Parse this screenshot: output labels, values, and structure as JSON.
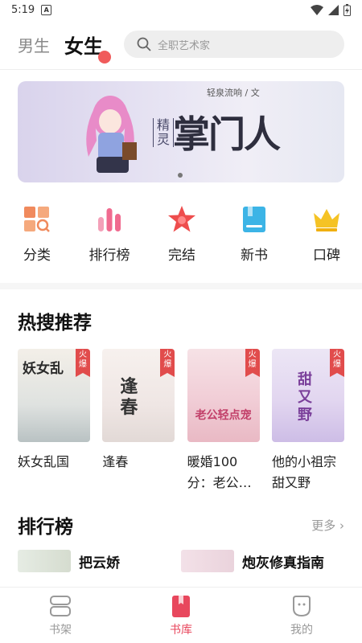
{
  "status": {
    "time": "5:19",
    "notification_letter": "A"
  },
  "header": {
    "tabs": [
      {
        "label": "男生"
      },
      {
        "label": "女生"
      }
    ],
    "search_placeholder": "全职艺术家"
  },
  "banner": {
    "author": "轻泉流响 / 文",
    "tag": "精灵",
    "title": "掌门人"
  },
  "categories": [
    {
      "label": "分类",
      "icon": "category-grid-icon",
      "color": "#f08a5d"
    },
    {
      "label": "排行榜",
      "icon": "ranking-bars-icon",
      "color": "#f06a8f"
    },
    {
      "label": "完结",
      "icon": "star-completed-icon",
      "color": "#ee4d4d"
    },
    {
      "label": "新书",
      "icon": "new-book-icon",
      "color": "#3cb4e6"
    },
    {
      "label": "口碑",
      "icon": "crown-icon",
      "color": "#f5c325"
    }
  ],
  "hot_search": {
    "title": "热搜推荐",
    "badge": "火爆",
    "books": [
      {
        "name": "妖女乱国",
        "cover_text": "妖女乱"
      },
      {
        "name": "逢春",
        "cover_text": "逢春"
      },
      {
        "name": "暖婚100分：老公…",
        "cover_text": "老公轻点宠"
      },
      {
        "name": "他的小祖宗甜又野",
        "cover_text": "甜又野"
      }
    ]
  },
  "ranking": {
    "title": "排行榜",
    "more": "更多",
    "items": [
      {
        "name": "把云娇"
      },
      {
        "name": "炮灰修真指南"
      }
    ]
  },
  "bottom_nav": [
    {
      "label": "书架",
      "icon": "bookshelf-icon"
    },
    {
      "label": "书库",
      "icon": "library-icon"
    },
    {
      "label": "我的",
      "icon": "profile-icon"
    }
  ],
  "colors": {
    "accent": "#e8475d",
    "hot_badge": "#e14c4c"
  }
}
